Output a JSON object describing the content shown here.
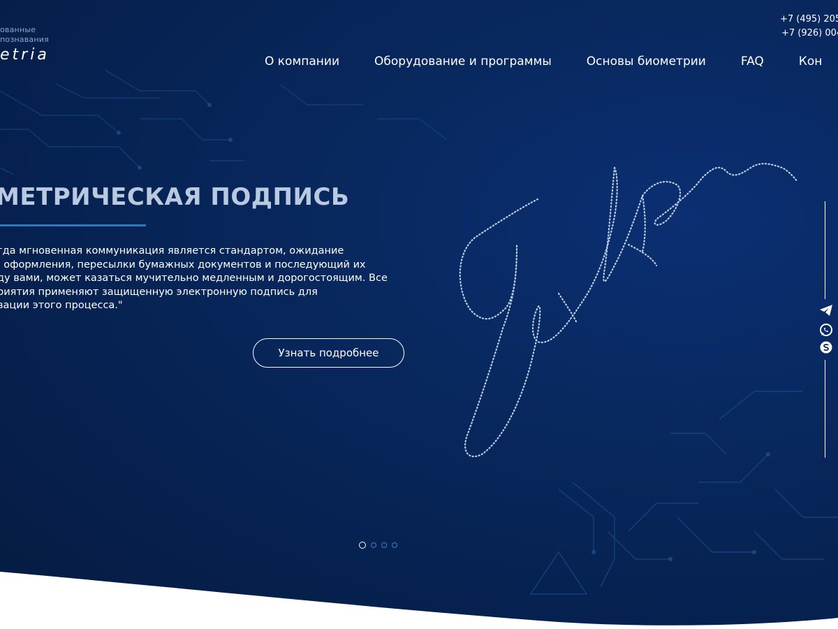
{
  "colors": {
    "hero_bg": "#08285f",
    "title": "#b9c9e0",
    "accent_underline": "#2d78c6",
    "text": "#ffffff",
    "logo_tagline": "#8ca6c9"
  },
  "logo": {
    "tagline_line1": "ованные",
    "tagline_line2": "познавания",
    "word": "etria"
  },
  "header": {
    "phones": [
      "+7 (495) 205",
      "+7 (926) 004"
    ]
  },
  "nav": {
    "items": [
      {
        "label": "О компании"
      },
      {
        "label": "Оборудование и программы"
      },
      {
        "label": "Основы биометрии"
      },
      {
        "label": "FAQ"
      },
      {
        "label": "Кон"
      }
    ]
  },
  "hero": {
    "title": "МЕТРИЧЕСКАЯ ПОДПИСЬ",
    "lines": [
      "гда мгновенная коммуникация является стандартом, ожидание",
      ", оформления, пересылки бумажных документов и последующий их",
      "ду вами, может казаться мучительно медленным и дорогостоящим. Все",
      "риятия применяют защищенную электронную подпись для",
      "вации этого процесса.\""
    ],
    "cta_label": "Узнать подробнее"
  },
  "slider": {
    "count": 4,
    "active_index": 0
  },
  "social": {
    "icons": [
      "telegram-icon",
      "whatsapp-icon",
      "skype-icon"
    ]
  }
}
